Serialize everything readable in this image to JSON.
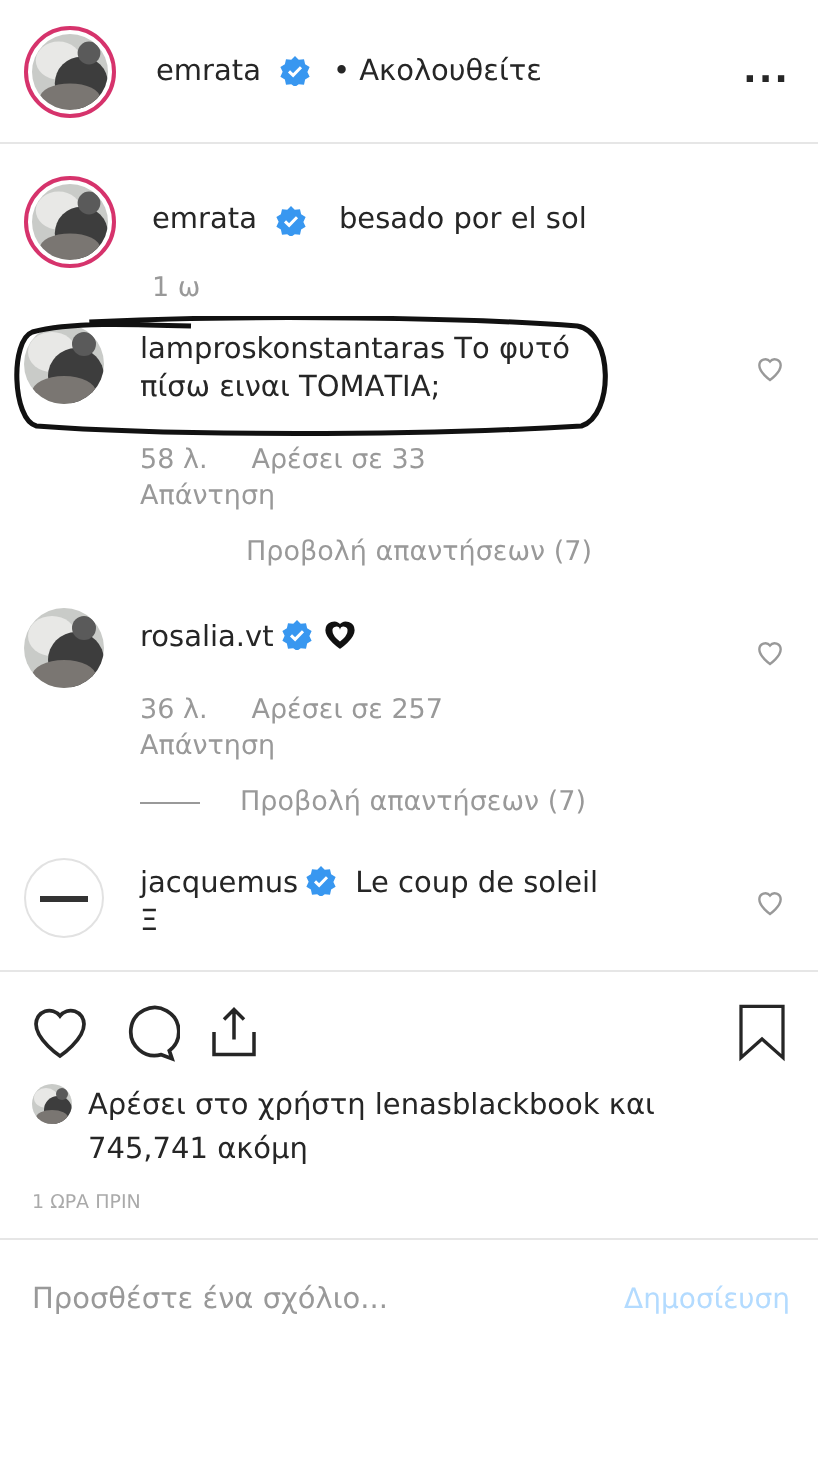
{
  "header": {
    "username": "emrata",
    "verified": true,
    "follow_label": "• Ακολουθείτε",
    "more": "..."
  },
  "caption": {
    "username": "emrata",
    "verified": true,
    "text": "besado por el sol",
    "time": "1 ω"
  },
  "comments": [
    {
      "kind": "user",
      "username": "lamproskonstantaras",
      "verified": false,
      "text": "Το φυτό πίσω ειναι ΤΟΜΑΤΙΑ;",
      "emoji_heart": false,
      "highlighted": true,
      "time": "58 λ.",
      "likes": "Αρέσει σε 33",
      "reply": "Απάντηση",
      "view_replies": "Προβολή απαντήσεων (7)",
      "replies_line": false
    },
    {
      "kind": "user",
      "username": "rosalia.vt",
      "verified": true,
      "emoji_heart": true,
      "highlighted": false,
      "time": "36 λ.",
      "likes": "Αρέσει σε 257",
      "reply": "Απάντηση",
      "view_replies": "Προβολή απαντήσεων (7)",
      "replies_line": true
    },
    {
      "kind": "brand",
      "username": "jacquemus",
      "verified": true,
      "text": "Le coup de soleil",
      "extra_line": "Ξ",
      "emoji_heart": false,
      "highlighted": false
    }
  ],
  "likes_summary": {
    "line1": "Αρέσει στο χρήστη lenasblackbook και",
    "line2": "745,741 ακόμη"
  },
  "timestamp": "1 ΩΡΑ ΠΡΙΝ",
  "comment_box": {
    "placeholder": "Προσθέστε ένα σχόλιο...",
    "post_button": "Δημοσίευση",
    "post_disabled": true
  }
}
